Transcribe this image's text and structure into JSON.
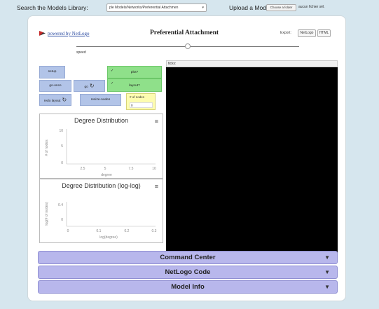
{
  "topbar": {
    "library_label": "Search the Models Library:",
    "library_value": "ple Models/Networks/Preferential Attachmen",
    "upload_label": "Upload a Model:",
    "file_button": "Choose a folder",
    "no_file_text": "aucun fichier sél."
  },
  "header": {
    "powered_by": "powered by NetLogo",
    "title": "Preferential Attachment",
    "export_label": "Export:",
    "export_netlogo": "NetLogo",
    "export_html": "HTML"
  },
  "slider": {
    "label": "speed",
    "value_fraction": 0.5
  },
  "buttons": {
    "setup": "setup",
    "go_once": "go-once",
    "go": "go",
    "redo_layout": "redo layout",
    "resize_nodes": "resize-nodes"
  },
  "switches": {
    "plot": {
      "label": "plot?",
      "on": true
    },
    "layout": {
      "label": "layout?",
      "on": true
    }
  },
  "monitor": {
    "label": "# of nodes",
    "value": "0"
  },
  "plots": {
    "degree": {
      "title": "Degree Distribution",
      "ylabel": "# of nodes",
      "xlabel": "degree",
      "yticks": [
        "10",
        "5",
        "0"
      ],
      "xticks": [
        "2.5",
        "5",
        "7.5",
        "10"
      ]
    },
    "degree_log": {
      "title": "Degree Distribution (log-log)",
      "ylabel": "log(# of nodes)",
      "xlabel": "log(degree)",
      "yticks": [
        "0.4",
        "0"
      ],
      "xticks": [
        "0",
        "0.1",
        "0.2",
        "0.3"
      ]
    }
  },
  "view": {
    "ticks_label": "ticks:",
    "background": "#000000"
  },
  "accordion": [
    "Command Center",
    "NetLogo Code",
    "Model Info"
  ],
  "colors": {
    "button": "#b2c4e8",
    "switch": "#8fe08a",
    "monitor": "#fdfcb0",
    "accordion": "#b8b7ec",
    "page": "#d6e6ee"
  }
}
